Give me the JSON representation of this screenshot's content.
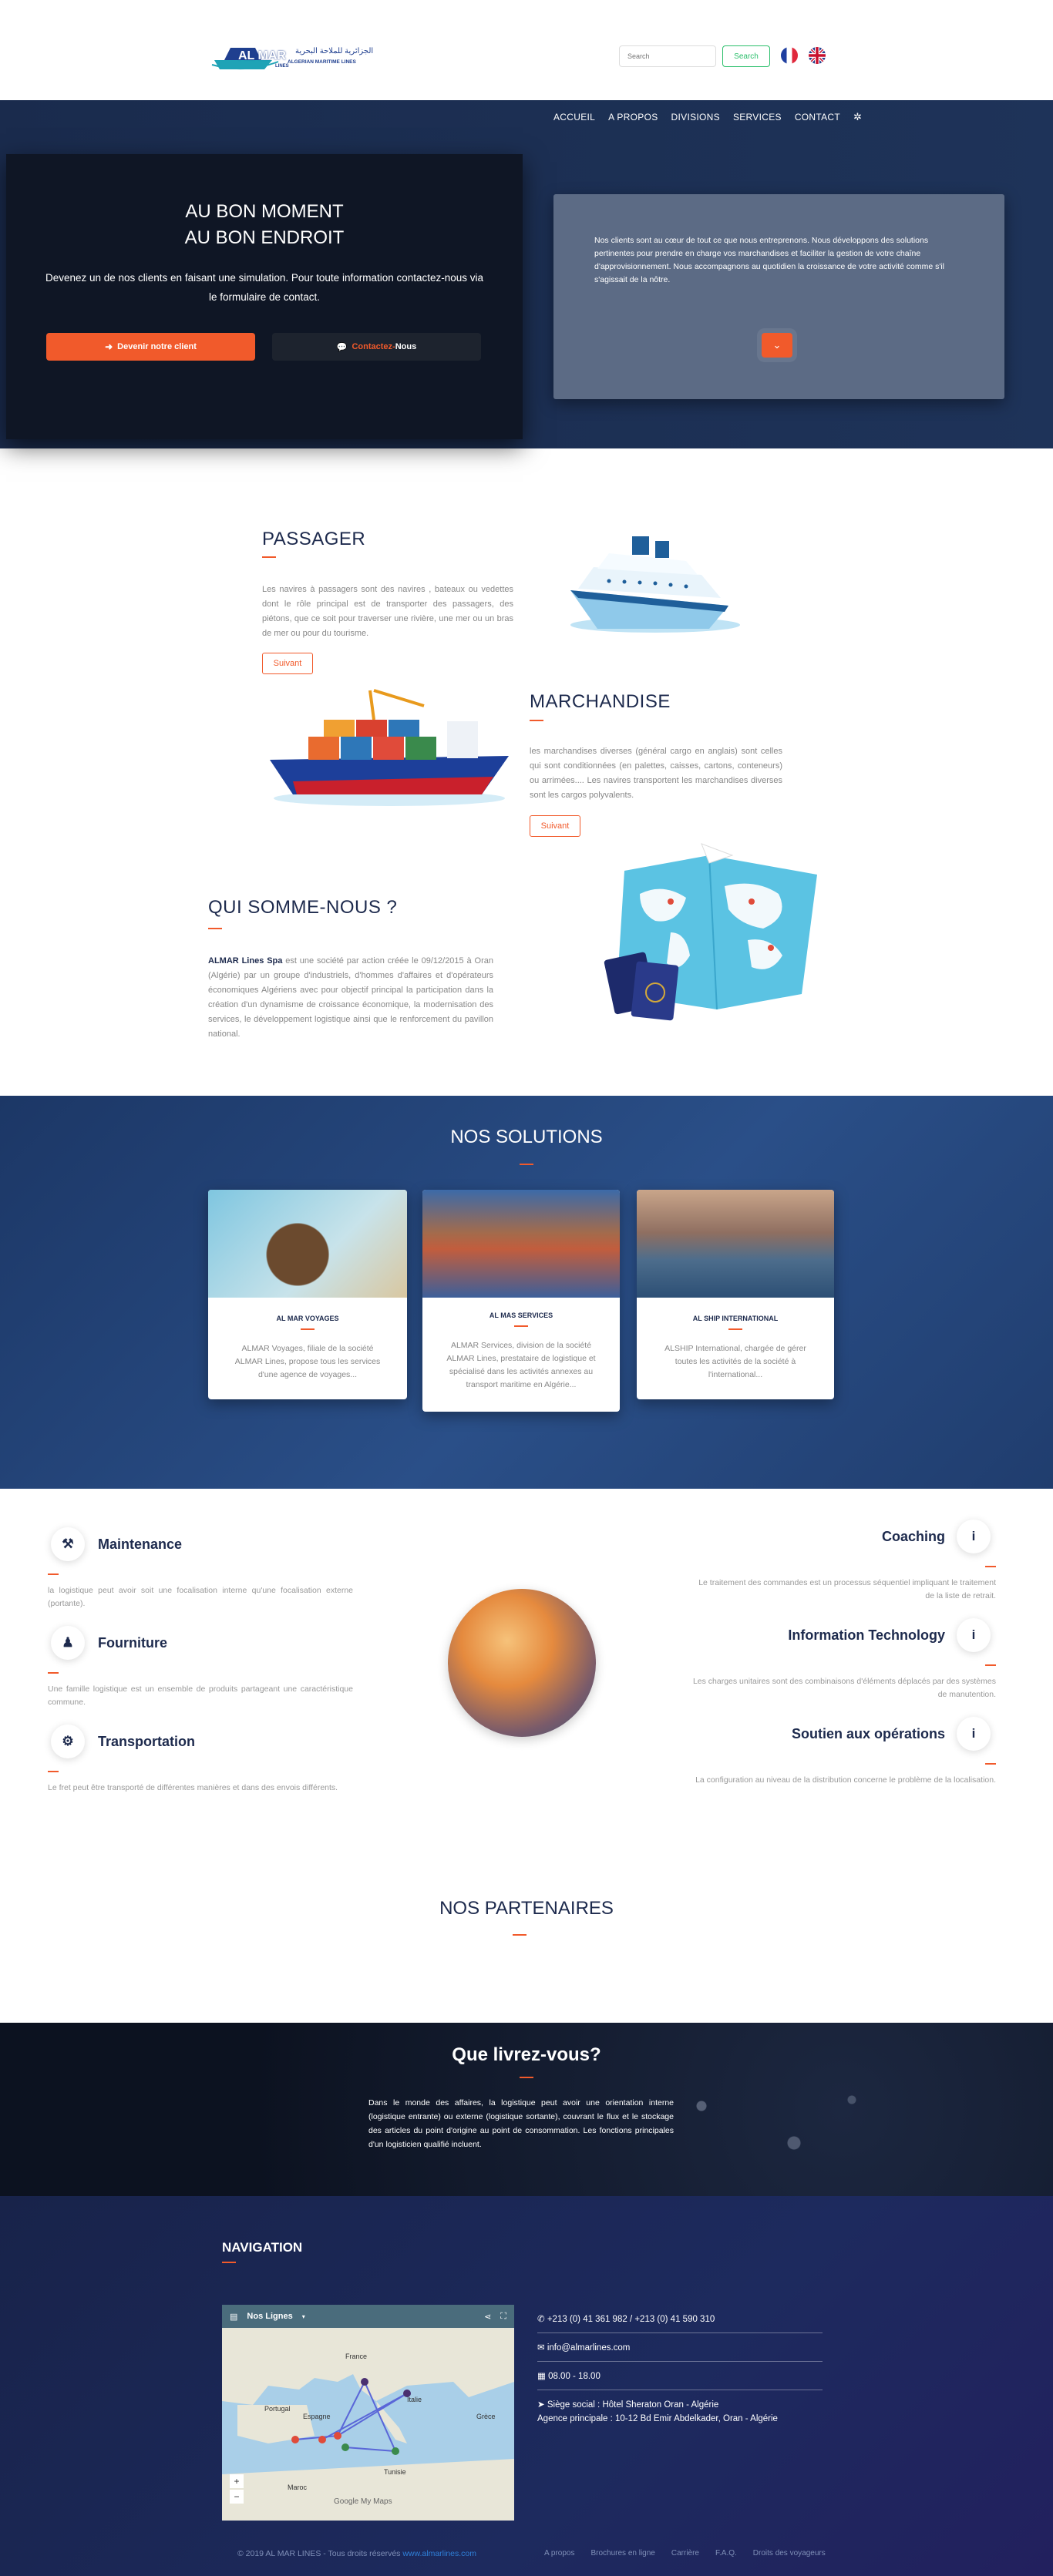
{
  "header": {
    "logo_text": "AL MAR",
    "logo_sub": "LINES",
    "logo_tagline": "ALGERIAN MARITIME LINES",
    "logo_arabic": "الجزائرية للملاحة البحرية",
    "search_placeholder": "Search",
    "search_button": "Search",
    "nav": [
      "ACCUEIL",
      "A PROPOS",
      "DIVISIONS",
      "SERVICES",
      "CONTACT"
    ]
  },
  "hero": {
    "title_line1": "AU BON MOMENT",
    "title_line2": "AU BON ENDROIT",
    "subtitle": "Devenez un de nos clients en faisant une simulation. Pour toute information contactez-nous via le formulaire de contact.",
    "btn_client": "Devenir notre client",
    "btn_contact_a": "Contactez-",
    "btn_contact_b": "Nous",
    "right_text": "Nos clients sont au cœur de tout ce que nous entreprenons. Nous développons des solutions pertinentes pour prendre en charge vos marchandises et faciliter la gestion de votre chaîne d'approvisionnement. Nous accompagnons au quotidien la croissance de votre activité comme s'il s'agissait de la nôtre."
  },
  "passager": {
    "title": "PASSAGER",
    "text": "Les navires à passagers sont des navires , bateaux ou vedettes dont le rôle principal est de transporter des passagers, des piétons, que ce soit pour traverser une rivière, une mer ou un bras de mer ou pour du tourisme.",
    "btn": "Suivant"
  },
  "marchandise": {
    "title": "MARCHANDISE",
    "text": "les marchandises diverses (général cargo en anglais) sont celles qui sont conditionnées (en palettes, caisses, cartons, conteneurs) ou arrimées.... Les navires transportent les marchandises diverses sont les cargos polyvalents.",
    "btn": "Suivant"
  },
  "qui": {
    "title": "QUI SOMME-NOUS ?",
    "brand": "ALMAR Lines Spa",
    "text": " est une société par action créée le 09/12/2015 à Oran (Algérie) par un groupe d'industriels, d'hommes d'affaires et d'opérateurs économiques Algériens avec pour objectif principal la participation dans la création d'un dynamisme de croissance économique, la modernisation des services, le développement logistique ainsi que le renforcement du pavillon national."
  },
  "solutions": {
    "title": "NOS SOLUTIONS",
    "cards": [
      {
        "title": "AL MAR VOYAGES",
        "text": "ALMAR Voyages, filiale de la société ALMAR Lines, propose tous les services d'une agence de voyages..."
      },
      {
        "title": "AL MAS SERVICES",
        "text": "ALMAR Services, division de la société ALMAR Lines, prestataire de logistique et spécialisé dans les activités annexes au transport maritime en Algérie..."
      },
      {
        "title": "AL SHIP INTERNATIONAL",
        "text": "ALSHIP International, chargée de gérer toutes les activités de la société à l'international..."
      }
    ]
  },
  "services": {
    "left": [
      {
        "title": "Maintenance",
        "text": "la logistique peut avoir soit une focalisation interne qu'une focalisation externe (portante)."
      },
      {
        "title": "Fourniture",
        "text": "Une famille logistique est un ensemble de produits partageant une caractéristique commune."
      },
      {
        "title": "Transportation",
        "text": "Le fret peut être transporté de différentes manières et dans des envois différents."
      }
    ],
    "right": [
      {
        "title": "Coaching",
        "text": "Le traitement des commandes est un processus séquentiel impliquant le traitement de la liste de retrait."
      },
      {
        "title": "Information Technology",
        "text": "Les charges unitaires sont des combinaisons d'éléments déplacés par des systèmes de manutention."
      },
      {
        "title": "Soutien aux opérations",
        "text": "La configuration au niveau de la distribution concerne le problème de la localisation."
      }
    ],
    "info_glyph": "i"
  },
  "partenaires": {
    "title": "NOS PARTENAIRES"
  },
  "livrez": {
    "title": "Que livrez-vous?",
    "text": "Dans le monde des affaires, la logistique peut avoir une orientation interne (logistique entrante) ou externe (logistique sortante), couvrant le flux et le stockage des articles du point d'origine au point de consommation. Les fonctions principales d'un logisticien qualifié incluent."
  },
  "footer": {
    "nav_title": "NAVIGATION",
    "map_title": "Nos Lignes",
    "map_labels": [
      "France",
      "Portugal",
      "Espagne",
      "Italie",
      "Grèce",
      "Maroc",
      "Tunisie"
    ],
    "map_google": "Google",
    "map_mymaps": "My Maps",
    "phone": "+213 (0) 41 361 982 / +213 (0) 41 590 310",
    "email": "info@almarlines.com",
    "hours": "08.00 - 18.00",
    "address1": "Siège social : Hôtel Sheraton Oran - Algérie",
    "address2": "Agence principale : 10-12 Bd Emir Abdelkader, Oran - Algérie",
    "copyright_a": "© 2019 AL MAR LINES - Tous droits réservés ",
    "copyright_link": "www.almarlines.com",
    "links": [
      "A propos",
      "Brochures en ligne",
      "Carrière",
      "F.A.Q.",
      "Droits des voyageurs"
    ]
  },
  "colors": {
    "accent": "#f15a2b",
    "navy": "#1d2a4d"
  }
}
